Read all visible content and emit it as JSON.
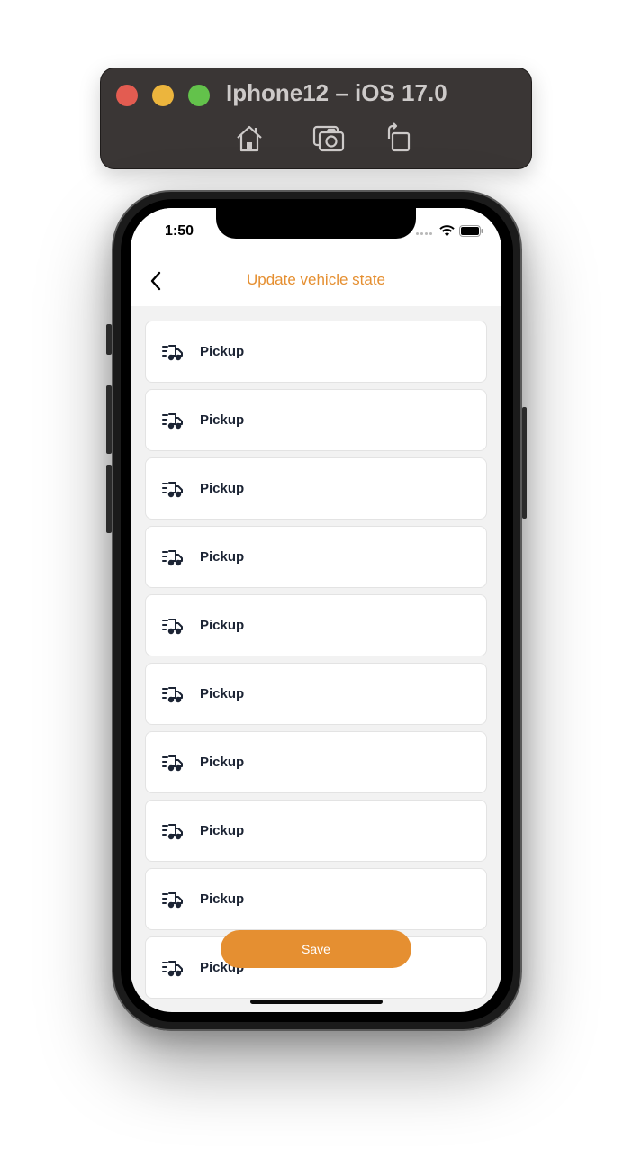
{
  "simulator": {
    "title": "Iphone12 – iOS 17.0",
    "icons": [
      "home-icon",
      "screenshot-icon",
      "rotate-icon"
    ]
  },
  "status_bar": {
    "time": "1:50",
    "icons": [
      "wifi-icon",
      "battery-icon"
    ]
  },
  "nav": {
    "title": "Update vehicle state",
    "back_icon": "chevron-left-icon"
  },
  "list": {
    "icon": "delivery-truck-icon",
    "items": [
      {
        "label": "Pickup"
      },
      {
        "label": "Pickup"
      },
      {
        "label": "Pickup"
      },
      {
        "label": "Pickup"
      },
      {
        "label": "Pickup"
      },
      {
        "label": "Pickup"
      },
      {
        "label": "Pickup"
      },
      {
        "label": "Pickup"
      },
      {
        "label": "Pickup"
      },
      {
        "label": "Pickup"
      }
    ]
  },
  "actions": {
    "save_label": "Save"
  },
  "colors": {
    "accent": "#e58f31",
    "text_dark": "#1c2434",
    "background": "#f2f2f2"
  }
}
